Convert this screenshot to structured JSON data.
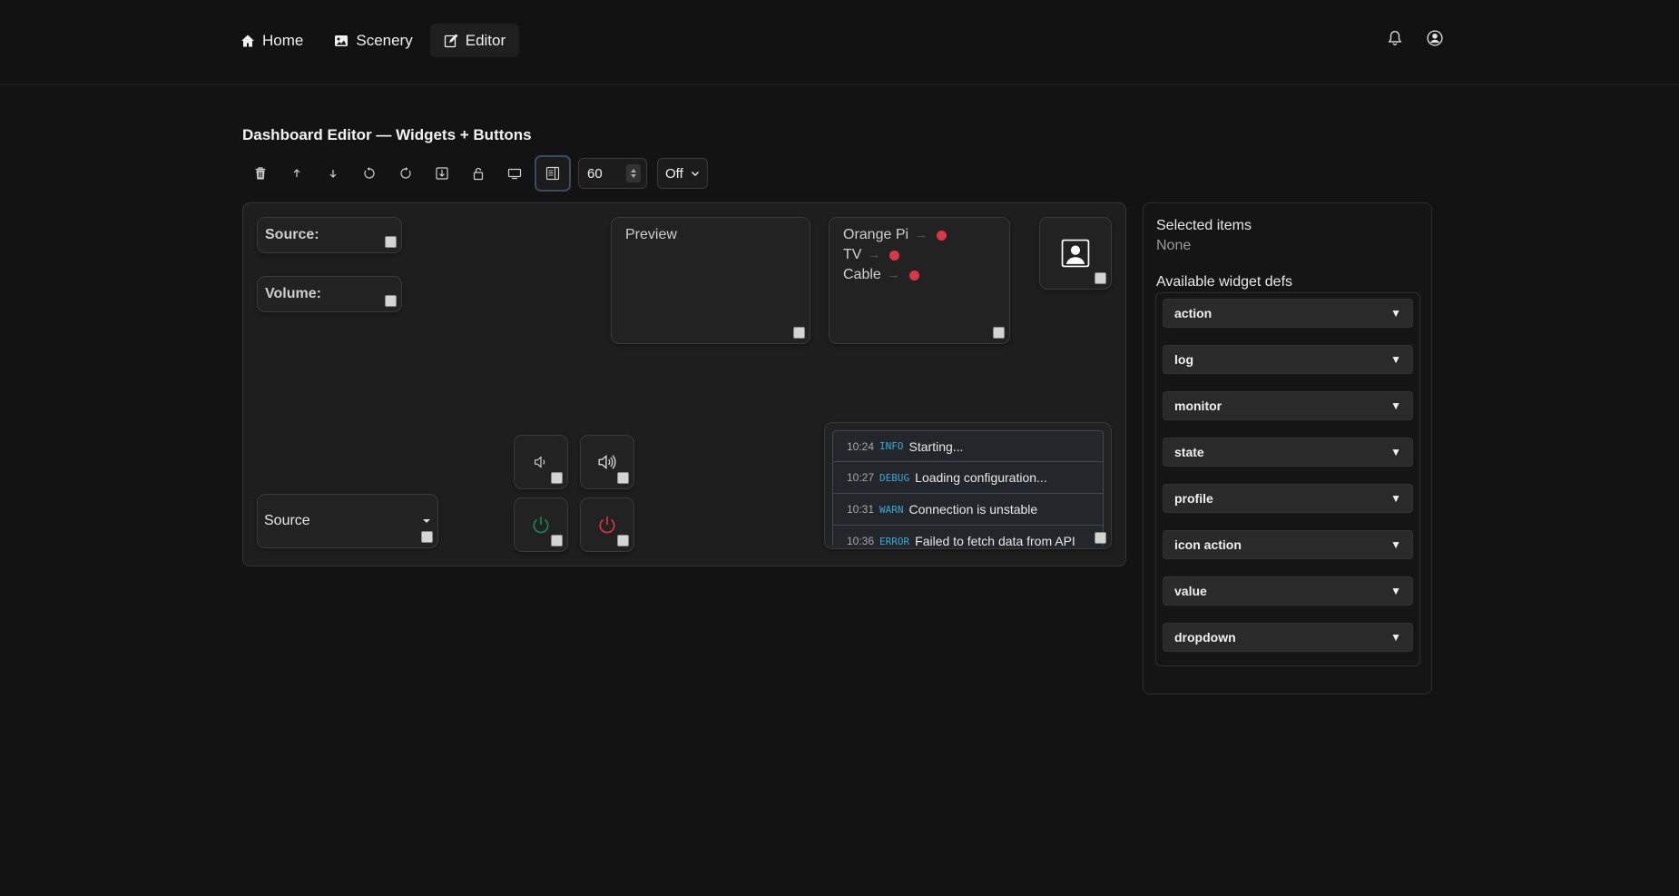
{
  "nav": {
    "items": [
      {
        "label": "Home",
        "icon": "home-icon"
      },
      {
        "label": "Scenery",
        "icon": "image-icon"
      },
      {
        "label": "Editor",
        "icon": "edit-icon",
        "active": true
      }
    ],
    "right_icons": [
      "bell-icon",
      "user-circle-icon"
    ]
  },
  "editor": {
    "title": "Dashboard Editor — Widgets + Buttons",
    "toolbar": {
      "buttons": [
        "trash-icon",
        "arrow-up-icon",
        "arrow-down-icon",
        "undo-icon",
        "redo-icon",
        "download-icon",
        "lock-icon",
        "display-icon",
        "layout-icon"
      ],
      "interval_value": "60",
      "mode_value": "Off"
    }
  },
  "widgets": {
    "source_label": "Source:",
    "volume_label": "Volume:",
    "preview_title": "Preview",
    "routes": [
      {
        "name": "Orange Pi"
      },
      {
        "name": "TV"
      },
      {
        "name": "Cable"
      }
    ],
    "source_dropdown": "Source",
    "log": [
      {
        "time": "10:24",
        "level": "INFO",
        "message": "Starting..."
      },
      {
        "time": "10:27",
        "level": "DEBUG",
        "message": "Loading configuration..."
      },
      {
        "time": "10:31",
        "level": "WARN",
        "message": "Connection is unstable"
      },
      {
        "time": "10:36",
        "level": "ERROR",
        "message": "Failed to fetch data from API"
      }
    ],
    "colors": {
      "power_on": "#198754",
      "power_off": "#dc3545",
      "status_dot": "#dc3545",
      "log_level": "#3aa7d8"
    }
  },
  "panel": {
    "selected_label": "Selected items",
    "selected_value": "None",
    "defs_label": "Available widget defs",
    "defs": [
      "action",
      "log",
      "monitor",
      "state",
      "profile",
      "icon action",
      "value",
      "dropdown"
    ],
    "expand_glyph": "▼"
  }
}
